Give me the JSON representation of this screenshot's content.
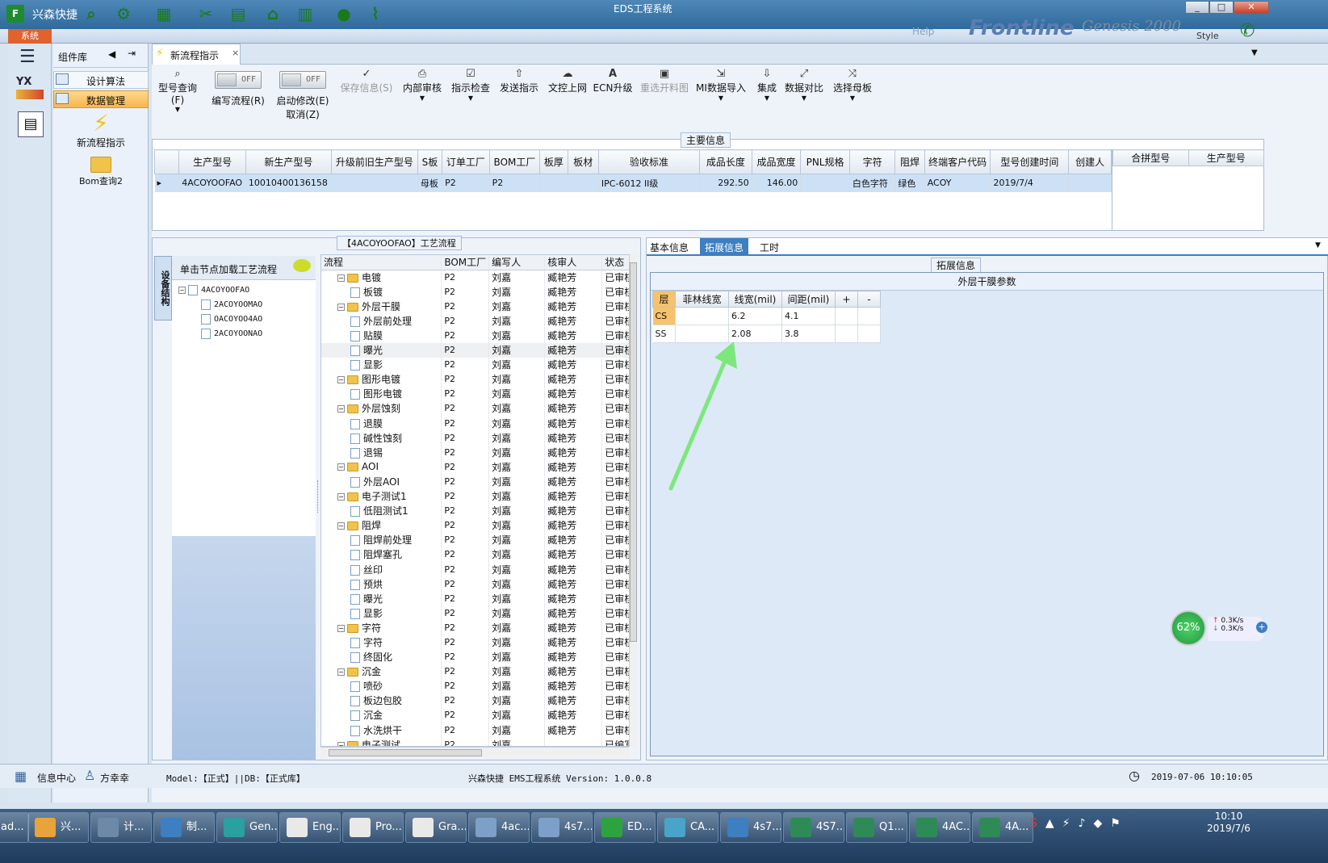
{
  "app": {
    "title": "EDS工程系统",
    "brand": "兴森快捷",
    "menu_system": "系统",
    "ribbon_labels": [
      "Help",
      "Frontline",
      "Genesis 2000",
      "Style"
    ]
  },
  "left_nav": {
    "items": [
      "组件库"
    ]
  },
  "component_panel": {
    "title": "组件库",
    "items": [
      {
        "label": "设计算法"
      },
      {
        "label": "数据管理"
      }
    ],
    "launchers": [
      {
        "label": "新流程指示"
      },
      {
        "label": "Bom查询2"
      }
    ]
  },
  "tab": {
    "label": "新流程指示"
  },
  "toolbar": {
    "items": [
      {
        "label": "型号查询(F)",
        "icon": "search-icon"
      },
      {
        "label": "编写流程(R)",
        "toggle": "OFF"
      },
      {
        "label": "启动修改(E)",
        "sublabel": "取消(Z)",
        "toggle": "OFF"
      },
      {
        "label": "保存信息(S)",
        "icon": "check-icon",
        "disabled": true
      },
      {
        "label": "内部审核",
        "icon": "print-icon"
      },
      {
        "label": "指示检查",
        "icon": "check-box-icon"
      },
      {
        "label": "发送指示",
        "icon": "upload-icon"
      },
      {
        "label": "文控上网",
        "icon": "cloud-upload-icon"
      },
      {
        "label": "ECN升级",
        "icon": "font-icon"
      },
      {
        "label": "重选开料图",
        "icon": "image-icon",
        "disabled": true
      },
      {
        "label": "MI数据导入",
        "icon": "import-icon"
      },
      {
        "label": "集成",
        "icon": "download-icon"
      },
      {
        "label": "数据对比",
        "icon": "compare-icon"
      },
      {
        "label": "选择母板",
        "icon": "shuffle-icon"
      }
    ]
  },
  "main_info": {
    "title": "主要信息",
    "columns": [
      "生产型号",
      "新生产型号",
      "升级前旧生产型号",
      "S板",
      "订单工厂",
      "BOM工厂",
      "板厚",
      "板材",
      "验收标准",
      "成品长度",
      "成品宽度",
      "PNL规格",
      "字符",
      "阻焊",
      "终端客户代码",
      "型号创建时间",
      "创建人"
    ],
    "rows": [
      [
        "4ACOYOOFAO",
        "10010400136158",
        "",
        "母板",
        "P2",
        "P2",
        "",
        "",
        "IPC-6012 II级",
        "292.50",
        "146.00",
        "",
        "白色字符",
        "绿色",
        "ACOY",
        "2019/7/4",
        ""
      ]
    ],
    "side_columns": [
      "合拼型号",
      "生产型号"
    ]
  },
  "process": {
    "title": "【4ACOYOOFAO】工艺流程",
    "side_tab": "设备结构",
    "hint": "单击节点加载工艺流程",
    "tree": [
      {
        "label": "4ACOYOOFAO",
        "level": 0
      },
      {
        "label": "2ACOYOOMAO",
        "level": 1
      },
      {
        "label": "OACOYOO4AO",
        "level": 1
      },
      {
        "label": "2ACOYOONAO",
        "level": 1
      }
    ],
    "columns": [
      "流程",
      "BOM工厂",
      "编写人",
      "核审人",
      "状态"
    ],
    "rows": [
      {
        "name": "电镀",
        "folder": true,
        "bom": "P2",
        "writer": "刘嘉",
        "reviewer": "臧艳芳",
        "status": "已审核"
      },
      {
        "name": "板镀",
        "folder": false,
        "bom": "P2",
        "writer": "刘嘉",
        "reviewer": "臧艳芳",
        "status": "已审核"
      },
      {
        "name": "外层干膜",
        "folder": true,
        "bom": "P2",
        "writer": "刘嘉",
        "reviewer": "臧艳芳",
        "status": "已审核"
      },
      {
        "name": "外层前处理",
        "folder": false,
        "bom": "P2",
        "writer": "刘嘉",
        "reviewer": "臧艳芳",
        "status": "已审核"
      },
      {
        "name": "贴膜",
        "folder": false,
        "bom": "P2",
        "writer": "刘嘉",
        "reviewer": "臧艳芳",
        "status": "已审核"
      },
      {
        "name": "曝光",
        "folder": false,
        "bom": "P2",
        "writer": "刘嘉",
        "reviewer": "臧艳芳",
        "status": "已审核"
      },
      {
        "name": "显影",
        "folder": false,
        "bom": "P2",
        "writer": "刘嘉",
        "reviewer": "臧艳芳",
        "status": "已审核"
      },
      {
        "name": "图形电镀",
        "folder": true,
        "bom": "P2",
        "writer": "刘嘉",
        "reviewer": "臧艳芳",
        "status": "已审核"
      },
      {
        "name": "图形电镀",
        "folder": false,
        "bom": "P2",
        "writer": "刘嘉",
        "reviewer": "臧艳芳",
        "status": "已审核"
      },
      {
        "name": "外层蚀刻",
        "folder": true,
        "bom": "P2",
        "writer": "刘嘉",
        "reviewer": "臧艳芳",
        "status": "已审核"
      },
      {
        "name": "退膜",
        "folder": false,
        "bom": "P2",
        "writer": "刘嘉",
        "reviewer": "臧艳芳",
        "status": "已审核"
      },
      {
        "name": "碱性蚀刻",
        "folder": false,
        "bom": "P2",
        "writer": "刘嘉",
        "reviewer": "臧艳芳",
        "status": "已审核"
      },
      {
        "name": "退锡",
        "folder": false,
        "bom": "P2",
        "writer": "刘嘉",
        "reviewer": "臧艳芳",
        "status": "已审核"
      },
      {
        "name": "AOI",
        "folder": true,
        "bom": "P2",
        "writer": "刘嘉",
        "reviewer": "臧艳芳",
        "status": "已审核"
      },
      {
        "name": "外层AOI",
        "folder": false,
        "bom": "P2",
        "writer": "刘嘉",
        "reviewer": "臧艳芳",
        "status": "已审核"
      },
      {
        "name": "电子测试1",
        "folder": true,
        "bom": "P2",
        "writer": "刘嘉",
        "reviewer": "臧艳芳",
        "status": "已审核"
      },
      {
        "name": "低阻测试1",
        "folder": false,
        "bom": "P2",
        "writer": "刘嘉",
        "reviewer": "臧艳芳",
        "status": "已审核"
      },
      {
        "name": "阻焊",
        "folder": true,
        "bom": "P2",
        "writer": "刘嘉",
        "reviewer": "臧艳芳",
        "status": "已审核"
      },
      {
        "name": "阻焊前处理",
        "folder": false,
        "bom": "P2",
        "writer": "刘嘉",
        "reviewer": "臧艳芳",
        "status": "已审核"
      },
      {
        "name": "阻焊塞孔",
        "folder": false,
        "bom": "P2",
        "writer": "刘嘉",
        "reviewer": "臧艳芳",
        "status": "已审核"
      },
      {
        "name": "丝印",
        "folder": false,
        "bom": "P2",
        "writer": "刘嘉",
        "reviewer": "臧艳芳",
        "status": "已审核"
      },
      {
        "name": "预烘",
        "folder": false,
        "bom": "P2",
        "writer": "刘嘉",
        "reviewer": "臧艳芳",
        "status": "已审核"
      },
      {
        "name": "曝光",
        "folder": false,
        "bom": "P2",
        "writer": "刘嘉",
        "reviewer": "臧艳芳",
        "status": "已审核"
      },
      {
        "name": "显影",
        "folder": false,
        "bom": "P2",
        "writer": "刘嘉",
        "reviewer": "臧艳芳",
        "status": "已审核"
      },
      {
        "name": "字符",
        "folder": true,
        "bom": "P2",
        "writer": "刘嘉",
        "reviewer": "臧艳芳",
        "status": "已审核"
      },
      {
        "name": "字符",
        "folder": false,
        "bom": "P2",
        "writer": "刘嘉",
        "reviewer": "臧艳芳",
        "status": "已审核"
      },
      {
        "name": "终固化",
        "folder": false,
        "bom": "P2",
        "writer": "刘嘉",
        "reviewer": "臧艳芳",
        "status": "已审核"
      },
      {
        "name": "沉金",
        "folder": true,
        "bom": "P2",
        "writer": "刘嘉",
        "reviewer": "臧艳芳",
        "status": "已审核"
      },
      {
        "name": "喷砂",
        "folder": false,
        "bom": "P2",
        "writer": "刘嘉",
        "reviewer": "臧艳芳",
        "status": "已审核"
      },
      {
        "name": "板边包胶",
        "folder": false,
        "bom": "P2",
        "writer": "刘嘉",
        "reviewer": "臧艳芳",
        "status": "已审核"
      },
      {
        "name": "沉金",
        "folder": false,
        "bom": "P2",
        "writer": "刘嘉",
        "reviewer": "臧艳芳",
        "status": "已审核"
      },
      {
        "name": "水洗烘干",
        "folder": false,
        "bom": "P2",
        "writer": "刘嘉",
        "reviewer": "臧艳芳",
        "status": "已审核"
      },
      {
        "name": "电子测试",
        "folder": true,
        "bom": "P2",
        "writer": "刘嘉",
        "reviewer": "",
        "status": "已编写"
      }
    ]
  },
  "detail": {
    "tabs": [
      "基本信息",
      "拓展信息",
      "工时"
    ],
    "active_tab": "拓展信息",
    "section_title": "拓展信息",
    "table_title": "外层干膜参数",
    "columns": [
      "层",
      "菲林线宽",
      "线宽(mil)",
      "间距(mil)",
      "+",
      "-"
    ],
    "rows": [
      [
        "CS",
        "",
        "6.2",
        "4.1",
        "",
        ""
      ],
      [
        "SS",
        "",
        "2.08",
        "3.8",
        "",
        ""
      ]
    ]
  },
  "network_widget": {
    "percent": "62%",
    "up": "0.3K/s",
    "down": "0.3K/s"
  },
  "statusbar": {
    "info_center": "信息中心",
    "user": "方幸幸",
    "model": "Model:【正式】||DB:【正式库】",
    "product": "兴森快捷 EMS工程系统 Version: 1.0.0.8",
    "datetime": "2019-07-06 10:10:05"
  },
  "taskbar": {
    "items": [
      "ad...",
      "兴...",
      "计...",
      "制...",
      "Gen...",
      "Eng...",
      "Pro...",
      "Gra...",
      "4ac...",
      "4s7...",
      "ED...",
      "CA...",
      "4s7...",
      "4S7...",
      "Q1...",
      "4AC...",
      "4A..."
    ],
    "clock_time": "10:10",
    "clock_date": "2019/7/6"
  },
  "colors": {
    "accent": "#3d7fc1",
    "selected_row": "#cde1f6",
    "arrow": "#7ce87c",
    "header_orange": "#f6c26b"
  }
}
